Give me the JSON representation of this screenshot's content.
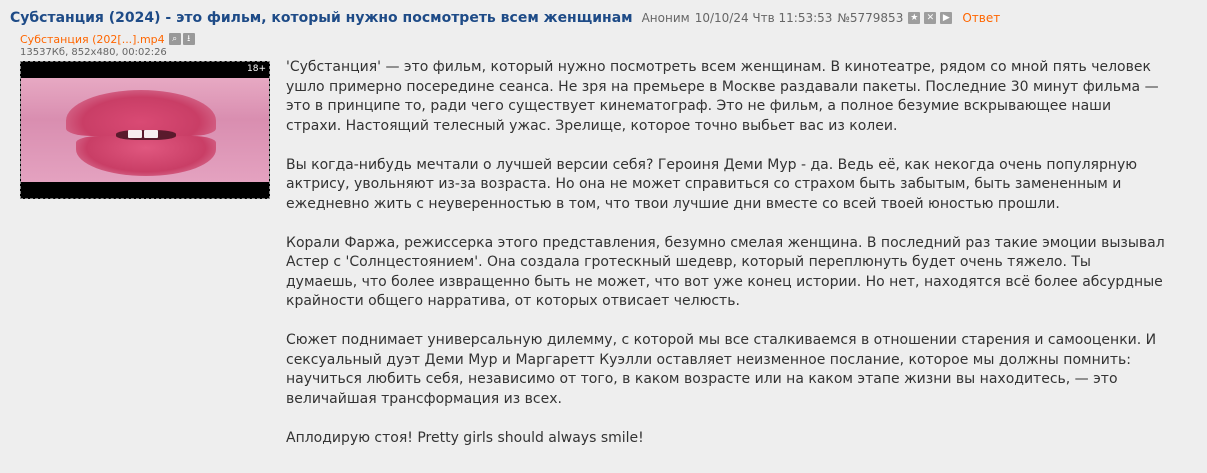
{
  "post": {
    "title": "Субстанция (2024) - это фильм, который нужно посмотреть всем женщинам",
    "author": "Аноним",
    "date": "10/10/24 Чтв 11:53:53",
    "number": "№5779853",
    "reply_label": "Ответ",
    "header_buttons": [
      "star-icon",
      "hide-icon",
      "play-icon"
    ]
  },
  "file": {
    "name": "Субстанция (202[...].mp4",
    "meta": "13537Кб, 852x480, 00:02:26",
    "age_badge": "18+",
    "buttons": [
      "search-icon",
      "download-icon"
    ]
  },
  "body": {
    "paragraphs": [
      "'Субстанция' — это фильм, который нужно посмотреть всем женщинам. В кинотеатре, рядом со мной пять человек ушло примерно посередине сеанса. Не зря на премьере в Москве раздавали пакеты. Последние 30 минут фильма — это в принципе то, ради чего существует кинематограф. Это не фильм, а полное безумие вскрывающее наши страхи. Настоящий телесный ужас. Зрелище, которое точно выбьет вас из колеи.",
      "Вы когда-нибудь мечтали о лучшей версии себя? Героиня Деми Мур - да. Ведь её, как некогда очень популярную актрису, увольняют из-за возраста. Но она не может справиться со страхом быть забытым, быть замененным и ежедневно жить с неуверенностью в том, что твои лучшие дни вместе со всей твоей юностью прошли.",
      "Корали Фаржа, режиссерка этого представления, безумно смелая женщина. В последний раз такие эмоции вызывал Астер с 'Солнцестоянием'. Она создала гротескный шедевр, который переплюнуть будет очень тяжело. Ты думаешь, что более извращенно быть не может, что вот уже конец истории. Но нет, находятся всё более абсурдные крайности общего нарратива, от которых отвисает челюсть.",
      "Сюжет поднимает универсальную дилемму, с которой мы все сталкиваемся в отношении старения и самооценки. И сексуальный дуэт Деми Мур и Маргаретт Куэлли оставляет неизменное послание, которое мы должны помнить: научиться любить себя, независимо от того, в каком возрасте или на каком этапе жизни вы находитесь, — это величайшая трансформация из всех.",
      "Аплодирую стоя! Pretty girls should always smile!"
    ]
  },
  "colors": {
    "title": "#1e4b87",
    "link": "#ff6600",
    "background": "#eeeeee",
    "text": "#333333"
  }
}
